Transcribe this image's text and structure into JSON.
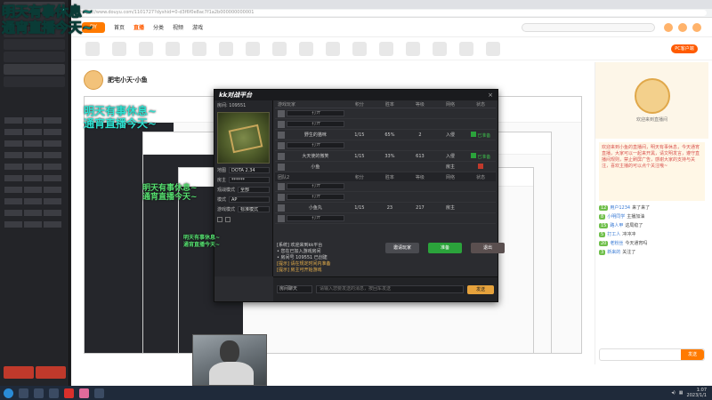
{
  "browser": {
    "url": "https://www.douyu.com/1101727?dyshid=0-d3f6f0e8ac7f1a2b000000000001",
    "nav": [
      "首页",
      "直播",
      "分类",
      "视频",
      "游戏"
    ],
    "active_nav": "直播",
    "pc_button": "PC客户端"
  },
  "overlay": {
    "caption_line1": "明天有事休息~",
    "caption_line2": "通宵直播今天~",
    "mirror_caption_1": "明天有事休息~",
    "mirror_caption_2": "通宵直播今天~"
  },
  "anchor": {
    "name": "肥宅小天·小鱼",
    "room_tag": "斗鱼"
  },
  "kk_dialog": {
    "logo": "kk对战平台",
    "close": "×",
    "room_no": "房间: 109551",
    "fields": [
      {
        "label": "地图",
        "value": "DOTA 2.34"
      },
      {
        "label": "房主",
        "value": "******"
      },
      {
        "label": "观战模式",
        "value": "全部"
      },
      {
        "label": "模式",
        "value": "AP"
      },
      {
        "label": "游戏模式",
        "value": "标准模式"
      }
    ],
    "columns": [
      "游戏玩家",
      "积分",
      "胜率",
      "等级",
      "网络",
      "状态"
    ],
    "rows": [
      {
        "name": "打开",
        "score": "",
        "rate": "",
        "level": "",
        "net": "",
        "state": ""
      },
      {
        "name": "打开",
        "score": "",
        "rate": "",
        "level": "",
        "net": "",
        "state": ""
      },
      {
        "name": "野生的猫咪",
        "score": "1/15",
        "rate": "65%",
        "level": "2",
        "net": "入侵",
        "state": "已准备"
      },
      {
        "name": "打开",
        "score": "",
        "rate": "",
        "level": "",
        "net": "",
        "state": ""
      },
      {
        "name": "大天使的微笑",
        "score": "1/15",
        "rate": "33%",
        "level": "613",
        "net": "入侵",
        "state": "已准备"
      },
      {
        "name": "小鱼",
        "score": "",
        "rate": "",
        "level": "",
        "net": "房主",
        "state": ""
      }
    ],
    "team2_header": [
      "团队2",
      "积分",
      "胜率",
      "等级",
      "网络",
      "状态"
    ],
    "rows2": [
      {
        "name": "打开",
        "score": "",
        "rate": "",
        "level": "",
        "net": "",
        "state": ""
      },
      {
        "name": "打开",
        "score": "",
        "rate": "",
        "level": "",
        "net": "",
        "state": ""
      },
      {
        "name": "小鱼丸",
        "score": "1/15",
        "rate": "23",
        "level": "217",
        "net": "房主",
        "state": ""
      },
      {
        "name": "打开",
        "score": "",
        "rate": "",
        "level": "",
        "net": "",
        "state": ""
      }
    ],
    "log": [
      "[系统] 欢迎来到kk平台",
      "• 您在已加入游戏房间",
      "• 房间号 109551 已创建",
      "[提示] 请在规定时间内准备",
      "[提示] 房主可开始游戏"
    ],
    "btn_invite": "邀请玩家",
    "btn_ready": "准备",
    "btn_leave": "退出",
    "chat_mode": "房间聊天",
    "chat_placeholder": "请输入您要发送的消息，按回车发送",
    "send": "发送"
  },
  "chat": {
    "notice": "欢迎来到直播间",
    "announce": "欢迎来到小鱼的直播间，明天有事休息，今天通宵直播，大家可以一起来开黑，请文明发言，遵守直播间规则，禁止刷屏广告，感谢大家的支持与关注，喜欢主播的可以点个关注哦~",
    "messages": [
      {
        "lv": "12",
        "name": "用户1234",
        "text": "来了来了"
      },
      {
        "lv": "8",
        "name": "小明同学",
        "text": "主播加油"
      },
      {
        "lv": "15",
        "name": "路人甲",
        "text": "这局稳了"
      },
      {
        "lv": "5",
        "name": "打工人",
        "text": "冲冲冲"
      },
      {
        "lv": "20",
        "name": "老粉丝",
        "text": "今天通宵吗"
      },
      {
        "lv": "3",
        "name": "新来的",
        "text": "关注了"
      }
    ],
    "send": "发送"
  },
  "taskbar": {
    "time": "1:07",
    "date": "2023/1/1"
  }
}
